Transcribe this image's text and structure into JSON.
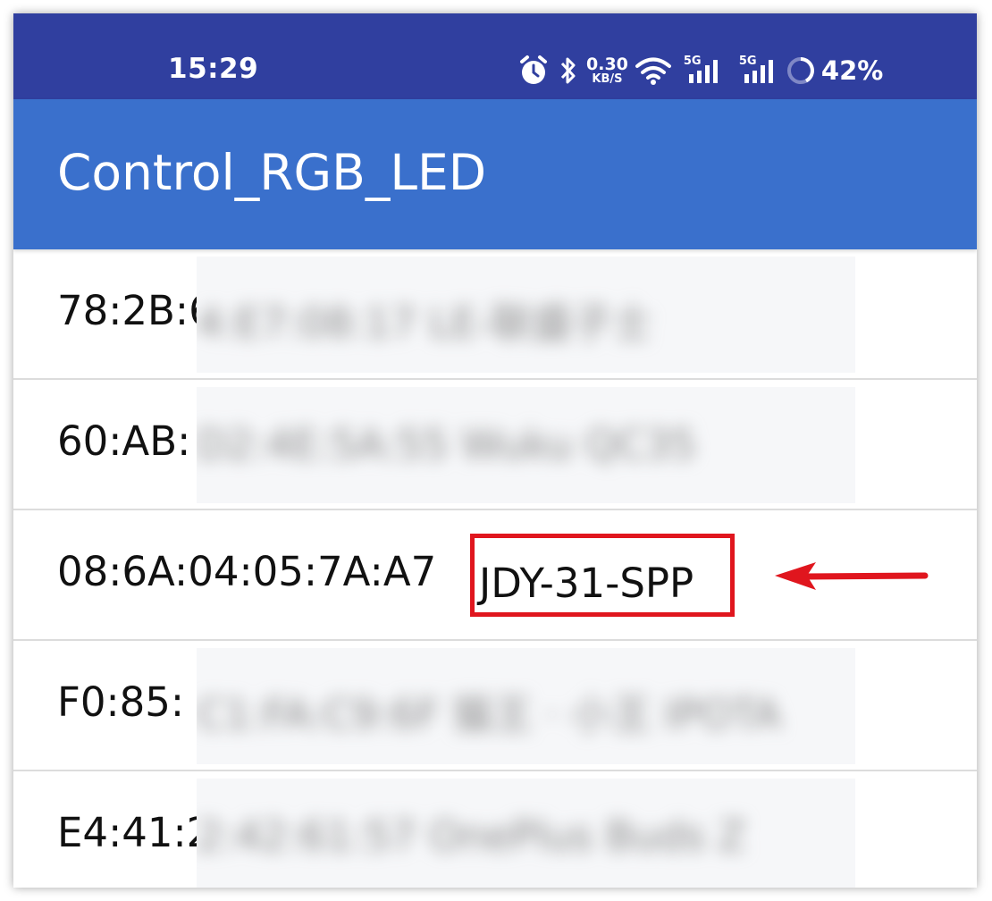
{
  "status_bar": {
    "time": "15:29",
    "net_speed_value": "0.30",
    "net_speed_unit": "KB/S",
    "signal1_label": "5G",
    "signal2_label": "5G",
    "battery_percent": "42%",
    "icons": [
      "alarm-icon",
      "bluetooth-icon",
      "wifi-icon",
      "signal-icon",
      "signal-icon",
      "battery-ring-icon"
    ]
  },
  "app_bar": {
    "title": "Control_RGB_LED"
  },
  "devices": [
    {
      "address_visible": "78:2B:6",
      "address_hidden": "4:E7:08:17 LE-联盛子士"
    },
    {
      "address_visible": "60:AB:",
      "address_hidden": "D2:4E:5A:55 Wuku QC35"
    },
    {
      "address_visible": "08:6A:04:05:7A:A7",
      "name": "JDY-31-SPP"
    },
    {
      "address_visible": "F0:85:",
      "address_hidden": "C1:FA:C9:6F 猫王 · 小王 IPOTA"
    },
    {
      "address_visible": "E4:41:2",
      "address_hidden": "2:42:61:57 OnePlus Buds Z"
    }
  ],
  "colors": {
    "status_bar": "#303F9F",
    "app_bar": "#3A70CC",
    "highlight": "#E0161E"
  }
}
